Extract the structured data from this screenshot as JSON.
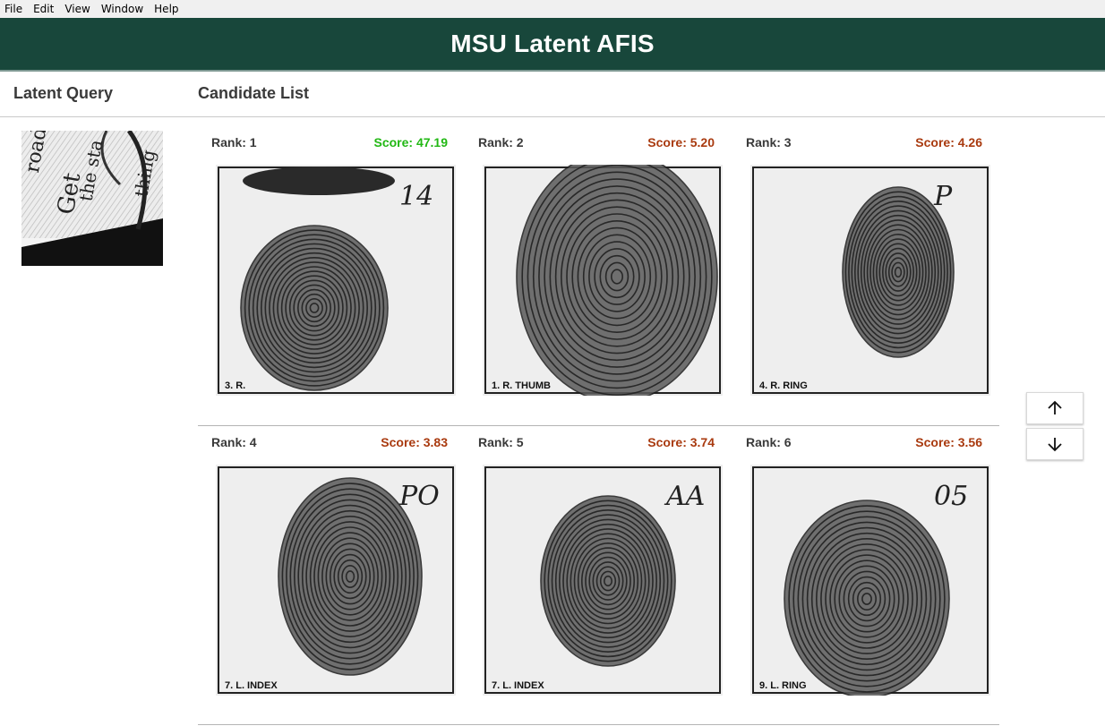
{
  "menu": [
    "File",
    "Edit",
    "View",
    "Window",
    "Help"
  ],
  "header": {
    "title": "MSU Latent AFIS"
  },
  "latent": {
    "heading": "Latent Query"
  },
  "candidates": {
    "heading": "Candidate List",
    "items": [
      {
        "rank": "Rank: 1",
        "score": "Score: 47.19",
        "finger_label": "3. R.",
        "card_mark": "14"
      },
      {
        "rank": "Rank: 2",
        "score": "Score: 5.20",
        "finger_label": "1. R. THUMB",
        "card_mark": ""
      },
      {
        "rank": "Rank: 3",
        "score": "Score: 4.26",
        "finger_label": "4. R. RING",
        "card_mark": "P"
      },
      {
        "rank": "Rank: 4",
        "score": "Score: 3.83",
        "finger_label": "7. L. INDEX",
        "card_mark": "PO"
      },
      {
        "rank": "Rank: 5",
        "score": "Score: 3.74",
        "finger_label": "7. L. INDEX",
        "card_mark": "AA"
      },
      {
        "rank": "Rank: 6",
        "score": "Score: 3.56",
        "finger_label": "9. L. RING",
        "card_mark": "05"
      }
    ]
  },
  "nav": {
    "up_icon": "arrow-up-icon",
    "down_icon": "arrow-down-icon"
  },
  "colors": {
    "header_bg": "#18473b",
    "score_best": "#22b814",
    "score_other": "#a93a0f"
  }
}
